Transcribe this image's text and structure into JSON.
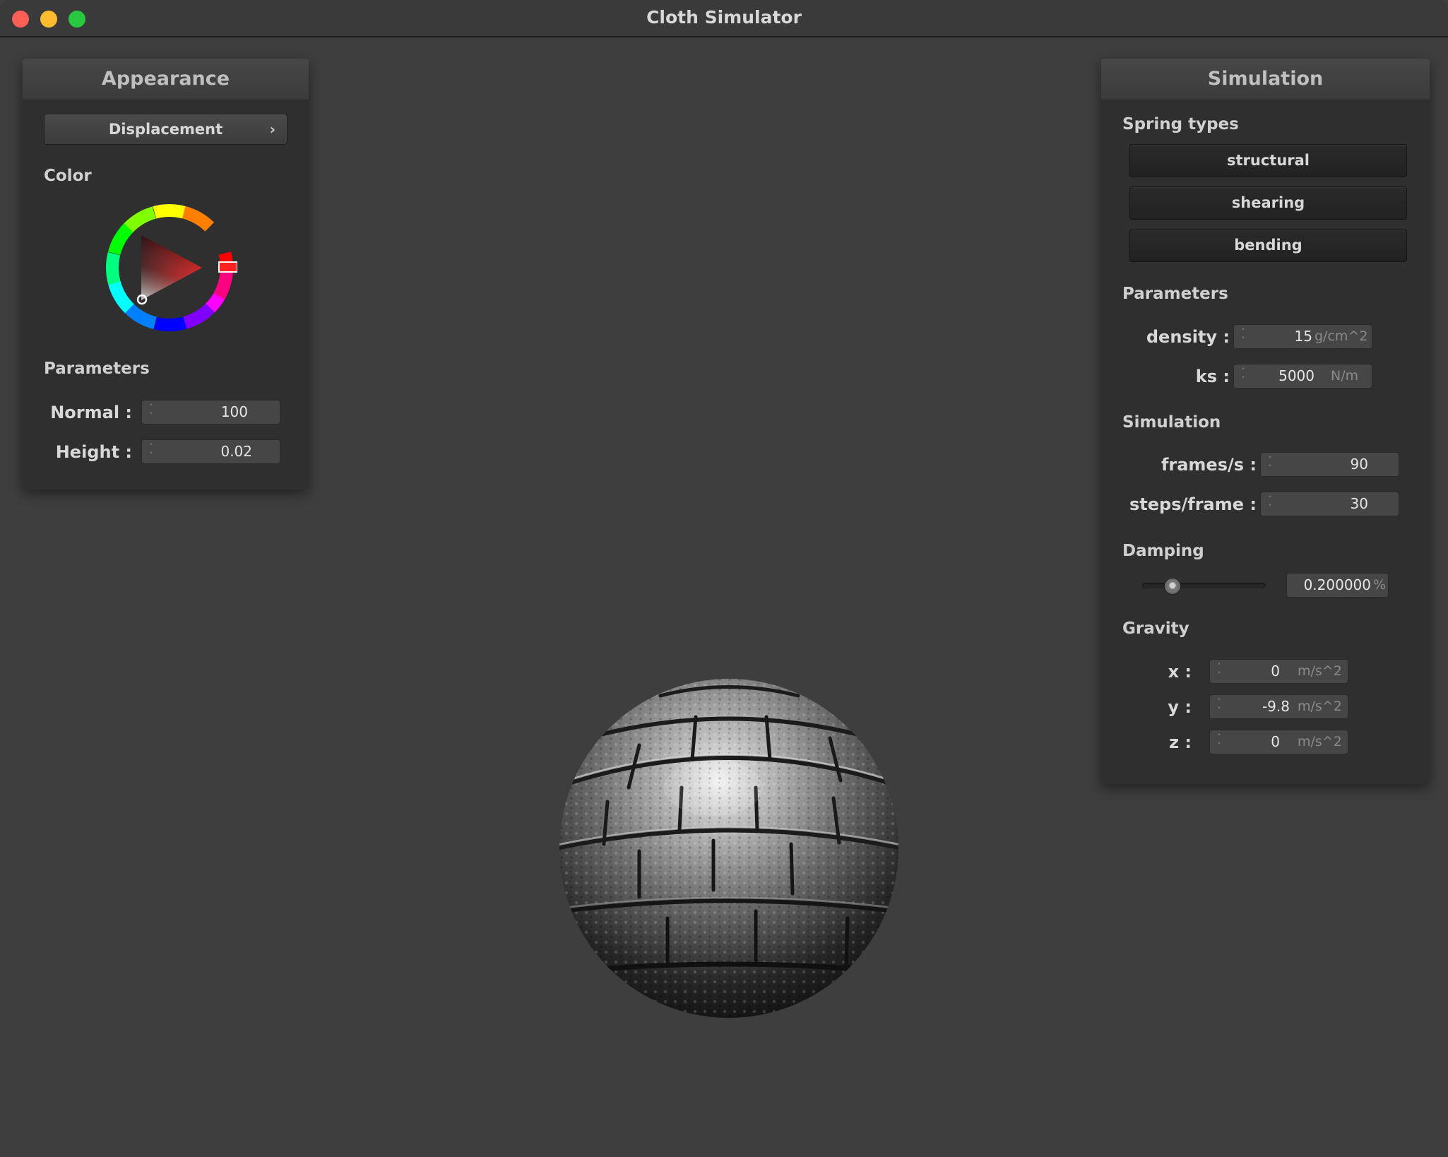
{
  "window": {
    "title": "Cloth Simulator"
  },
  "appearance": {
    "title": "Appearance",
    "shader_button": "Displacement",
    "color_label": "Color",
    "params_label": "Parameters",
    "normal": {
      "label": "Normal :",
      "value": "100"
    },
    "height": {
      "label": "Height :",
      "value": "0.02"
    },
    "color_value": "#ff2020"
  },
  "simulation": {
    "title": "Simulation",
    "spring_types_label": "Spring types",
    "springs": [
      "structural",
      "shearing",
      "bending"
    ],
    "params_label": "Parameters",
    "density": {
      "label": "density :",
      "value": "15",
      "unit": "g/cm^2"
    },
    "ks": {
      "label": "ks :",
      "value": "5000",
      "unit": "N/m"
    },
    "sim_label": "Simulation",
    "fps": {
      "label": "frames/s :",
      "value": "90"
    },
    "steps": {
      "label": "steps/frame :",
      "value": "30"
    },
    "damping_label": "Damping",
    "damping": {
      "value": "0.200000",
      "unit": "%",
      "fraction": 0.1
    },
    "gravity_label": "Gravity",
    "gravity": {
      "x": {
        "label": "x :",
        "value": "0",
        "unit": "m/s^2"
      },
      "y": {
        "label": "y :",
        "value": "-9.8",
        "unit": "m/s^2"
      },
      "z": {
        "label": "z :",
        "value": "0",
        "unit": "m/s^2"
      }
    }
  },
  "scene": {
    "object": "sphere"
  }
}
